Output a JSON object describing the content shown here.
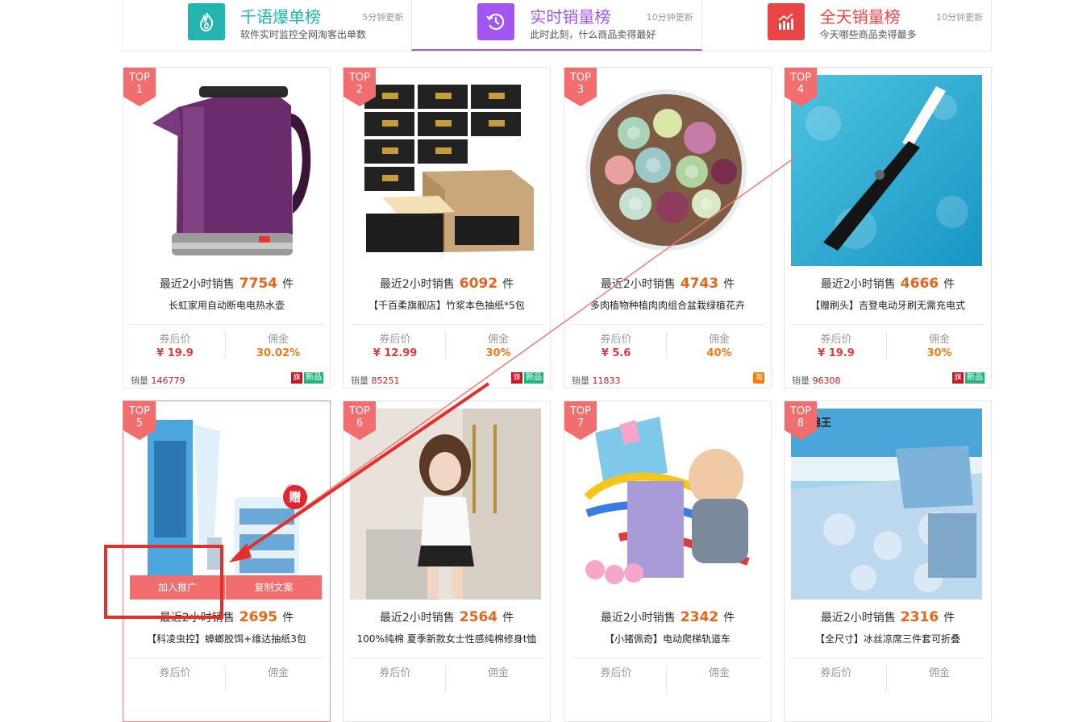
{
  "tabs": [
    {
      "title": "千语爆单榜",
      "subtitle": "软件实时监控全网淘客出单数",
      "update": "5分钟更新",
      "color": "#22b5b0",
      "icon": "flame-icon",
      "active": false
    },
    {
      "title": "实时销量榜",
      "subtitle": "此时此刻，什么商品卖得最好",
      "update": "10分钟更新",
      "color": "#a355f2",
      "icon": "clock-history-icon",
      "active": true
    },
    {
      "title": "全天销量榜",
      "subtitle": "今天哪些商品卖得最多",
      "update": "10分钟更新",
      "color": "#e94545",
      "icon": "bar-chart-icon",
      "active": false
    }
  ],
  "labels": {
    "top": "TOP",
    "sales_prefix": "最近2小时销售",
    "sales_unit": "件",
    "coupon_price": "券后价",
    "commission": "佣金",
    "volume_prefix": "销量",
    "new_badge": "新品",
    "store_badge": "旗",
    "tao_badge": "淘"
  },
  "products": [
    {
      "rank": "1",
      "sales": "7754",
      "name": "长虹家用自动断电电热水壶",
      "price": "¥ 19.9",
      "commission": "30.02%",
      "volume": "146779",
      "badges": [
        "store",
        "new"
      ],
      "image": "purple-electric-kettle"
    },
    {
      "rank": "2",
      "sales": "6092",
      "name": "【千百柔旗舰店】竹浆本色抽纸*5包",
      "price": "¥ 12.99",
      "commission": "30%",
      "volume": "85251",
      "badges": [
        "store",
        "new"
      ],
      "image": "tissue-boxes"
    },
    {
      "rank": "3",
      "sales": "4743",
      "name": "多肉植物种植肉肉组合盆栽绿植花卉",
      "price": "¥ 5.6",
      "commission": "40%",
      "volume": "11833",
      "badges": [
        "tao"
      ],
      "image": "succulent-plants"
    },
    {
      "rank": "4",
      "sales": "4666",
      "name": "【赠刷头】吉登电动牙刷无需充电式",
      "price": "¥ 19.9",
      "commission": "30%",
      "volume": "96308",
      "badges": [
        "store",
        "new"
      ],
      "image": "electric-toothbrush"
    },
    {
      "rank": "5",
      "sales": "2695",
      "name": "【科凌虫控】蟑螂胶饵+维达抽纸3包",
      "price": "",
      "commission": "",
      "volume": "",
      "badges": [],
      "image": "cockroach-gel",
      "highlight": true,
      "actions": {
        "add": "加入推广",
        "copy": "复制文案"
      },
      "gift": "赠"
    },
    {
      "rank": "6",
      "sales": "2564",
      "name": "100%纯棉 夏季新款女士性感纯棉修身t恤",
      "price": "",
      "commission": "",
      "volume": "",
      "badges": [],
      "image": "woman-tshirt"
    },
    {
      "rank": "7",
      "sales": "2342",
      "name": "【小猪佩奇】电动爬梯轨道车",
      "price": "",
      "commission": "",
      "volume": "",
      "badges": [],
      "image": "peppa-track-toy"
    },
    {
      "rank": "8",
      "sales": "2316",
      "name": "【全尺寸】冰丝凉席三件套可折叠",
      "price": "",
      "commission": "",
      "volume": "",
      "badges": [],
      "image": "ice-silk-mat",
      "brand_text": "锦王"
    }
  ]
}
